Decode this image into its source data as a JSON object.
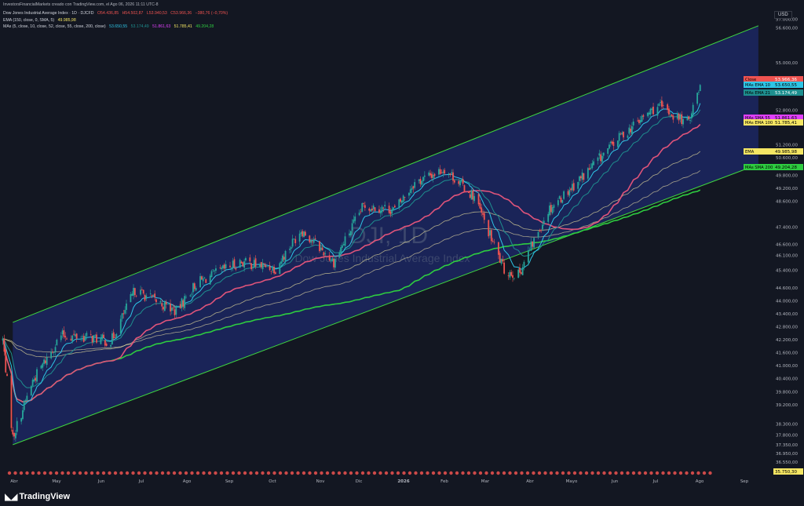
{
  "header": {
    "creator_line": "InvestorsFinancialMarkets creado con TradingView.com, el Ago 06, 2026 11:11 UTC-8",
    "symbol_line": {
      "name": "Dow Jones Industrial Average Index · 1D · DJCFD",
      "open": "O54.436,85",
      "high": "H54.502,87",
      "low": "L53.940,53",
      "close": "C53.966,36",
      "change": "−380,76 (−0,70%)"
    },
    "ema_line": {
      "label": "EMA (150, close, 0, SMA, 5)",
      "value": "49.985,98"
    },
    "mas_line": {
      "label": "MAs (5, close, 10, close, 52, close, 55, close, 200, close)",
      "values": [
        "53.650,55",
        "53.174,49",
        "51.861,63",
        "51.785,41",
        "49.204,28"
      ]
    }
  },
  "axis_currency": "USD",
  "watermark": {
    "symbol": "DJI, 1D",
    "name": "Dow Jones Industrial Average Index"
  },
  "brand": "TradingView",
  "colors": {
    "background": "#131722",
    "channel_line": "#3fd63f",
    "channel_fill": "#1d2a6b",
    "candle_up": "#26a69a",
    "candle_down": "#ef5350",
    "ema10": "#2ec5e6",
    "ema21": "#1e8f8f",
    "sma55": "#e0547a",
    "ema100": "#f0e6a0",
    "ema150": "#c9c09a",
    "sma200": "#2ecc40"
  },
  "chart_data": {
    "type": "candlestick",
    "title": "DJI, 1D",
    "subtitle": "Dow Jones Industrial Average Index",
    "ylim": [
      36150,
      57600
    ],
    "y_ticks": [
      "57.000,00",
      "56.600,00",
      "55.000,00",
      "54.200,00",
      "53.600,00",
      "52.800,00",
      "52.200,00",
      "51.200,00",
      "50.600,00",
      "49.800,00",
      "49.200,00",
      "48.600,00",
      "47.400,00",
      "46.600,00",
      "46.100,00",
      "45.400,00",
      "44.600,00",
      "44.000,00",
      "43.400,00",
      "42.800,00",
      "42.200,00",
      "41.600,00",
      "41.000,00",
      "40.400,00",
      "39.800,00",
      "39.200,00",
      "38.300,00",
      "37.800,00",
      "37.350,00",
      "36.950,00",
      "36.550,00",
      "36.150,00"
    ],
    "x_labels": [
      "Abr",
      "May",
      "Jun",
      "Jul",
      "Ago",
      "Sep",
      "Oct",
      "Nov",
      "Dic",
      "2026",
      "Feb",
      "Mar",
      "Abr",
      "Mayo",
      "Jun",
      "Jul",
      "Ago",
      "Sep"
    ],
    "keyframes": [
      {
        "date": "2025-04-01",
        "close": 42200
      },
      {
        "date": "2025-04-08",
        "close": 37700
      },
      {
        "date": "2025-04-22",
        "close": 40300
      },
      {
        "date": "2025-05-12",
        "close": 42400
      },
      {
        "date": "2025-06-02",
        "close": 42300
      },
      {
        "date": "2025-06-16",
        "close": 42100
      },
      {
        "date": "2025-07-03",
        "close": 44500
      },
      {
        "date": "2025-08-01",
        "close": 43500
      },
      {
        "date": "2025-08-15",
        "close": 44800
      },
      {
        "date": "2025-09-15",
        "close": 45800
      },
      {
        "date": "2025-10-10",
        "close": 45500
      },
      {
        "date": "2025-10-28",
        "close": 47300
      },
      {
        "date": "2025-11-20",
        "close": 45800
      },
      {
        "date": "2025-12-11",
        "close": 48400
      },
      {
        "date": "2026-01-02",
        "close": 48200
      },
      {
        "date": "2026-01-15",
        "close": 49400
      },
      {
        "date": "2026-02-06",
        "close": 50100
      },
      {
        "date": "2026-02-27",
        "close": 48800
      },
      {
        "date": "2026-03-20",
        "close": 45400
      },
      {
        "date": "2026-03-30",
        "close": 45200
      },
      {
        "date": "2026-04-20",
        "close": 48200
      },
      {
        "date": "2026-05-15",
        "close": 49800
      },
      {
        "date": "2026-06-10",
        "close": 51600
      },
      {
        "date": "2026-07-06",
        "close": 53000
      },
      {
        "date": "2026-07-27",
        "close": 52200
      },
      {
        "date": "2026-08-05",
        "close": 53966
      }
    ],
    "channel": {
      "upper": [
        {
          "date": "2025-04-08",
          "value": 43000
        },
        {
          "date": "2026-09-15",
          "value": 56700
        }
      ],
      "lower": [
        {
          "date": "2025-04-08",
          "value": 37350
        },
        {
          "date": "2026-09-15",
          "value": 50300
        }
      ]
    },
    "price_labels": [
      {
        "name": "Close",
        "value": "53.966,36",
        "color": "#ef5350"
      },
      {
        "name": "MAs EMA 10",
        "value": "53.650,55",
        "color": "#2ec5e6"
      },
      {
        "name": "MAs EMA 21",
        "value": "53.174,49",
        "color": "#1e8f8f"
      },
      {
        "name": "MAs SMA 55",
        "value": "51.861,63",
        "color": "#e040fb"
      },
      {
        "name": "MAs EMA 100",
        "value": "51.785,41",
        "color": "#f5e663"
      },
      {
        "name": "EMA",
        "value": "49.985,98",
        "color": "#f5e663"
      },
      {
        "name": "MAs SMA 200",
        "value": "49.204,28",
        "color": "#2ecc40"
      },
      {
        "name": "",
        "value": "35.750,30",
        "color": "#f5e663"
      }
    ]
  }
}
